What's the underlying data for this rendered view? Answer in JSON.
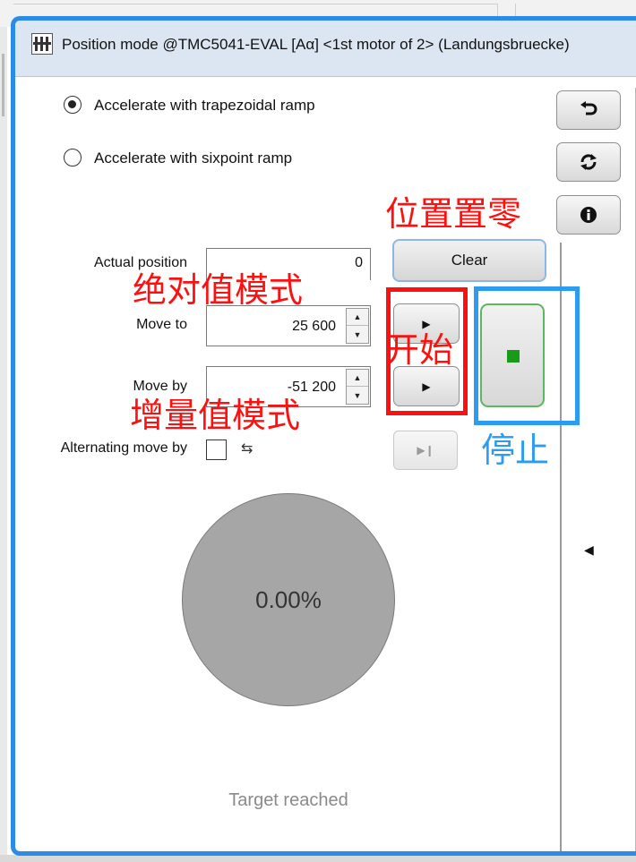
{
  "window": {
    "title": "Position mode @TMC5041-EVAL [Aα] <1st motor of 2> (Landungsbruecke)",
    "accent_color": "#2b8be8"
  },
  "ramp": {
    "options": [
      {
        "label": "Accelerate with trapezoidal ramp",
        "selected": true
      },
      {
        "label": "Accelerate with sixpoint ramp",
        "selected": false
      }
    ]
  },
  "side_buttons": {
    "undo_icon": "undo-arrow-icon",
    "refresh_icon": "refresh-icon",
    "info_icon": "info-icon"
  },
  "position": {
    "actual_label": "Actual position",
    "actual_value": "0",
    "clear_label": "Clear",
    "move_to_label": "Move to",
    "move_to_value": "25 600",
    "move_by_label": "Move by",
    "move_by_value": "-51 200",
    "alternating_label": "Alternating move by",
    "alternating_checked": false
  },
  "progress": {
    "percent_text": "0.00%",
    "status_text": "Target reached"
  },
  "annotations": {
    "zero_position": "位置置零",
    "absolute_mode": "绝对值模式",
    "start": "开始",
    "incremental_mode": "增量值模式",
    "stop": "停止",
    "red_color": "#ff1010",
    "blue_color": "#2d9cf0"
  }
}
